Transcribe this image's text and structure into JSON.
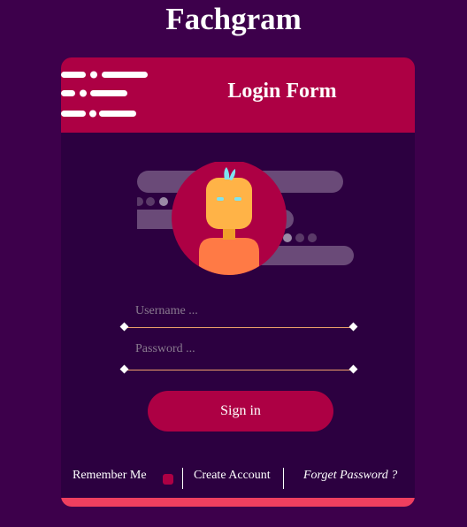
{
  "site": {
    "title": "Fachgram"
  },
  "card": {
    "title": "Login Form"
  },
  "form": {
    "username": {
      "placeholder": "Username ...",
      "value": ""
    },
    "password": {
      "placeholder": "Password ...",
      "value": ""
    },
    "signin_label": "Sign in"
  },
  "footer": {
    "remember_label": "Remember Me",
    "create_account_label": "Create Account",
    "forget_password_label": "Forget Password ?"
  },
  "colors": {
    "page_background": "#3d004b",
    "card_background": "#2c0040",
    "accent": "#ad0044",
    "bottom_bar": "#ef3f5f",
    "input_underline": "#f0a06a"
  },
  "icons": {
    "header_decoration": "speed-lines-decoration",
    "avatar": "user-avatar-illustration"
  }
}
